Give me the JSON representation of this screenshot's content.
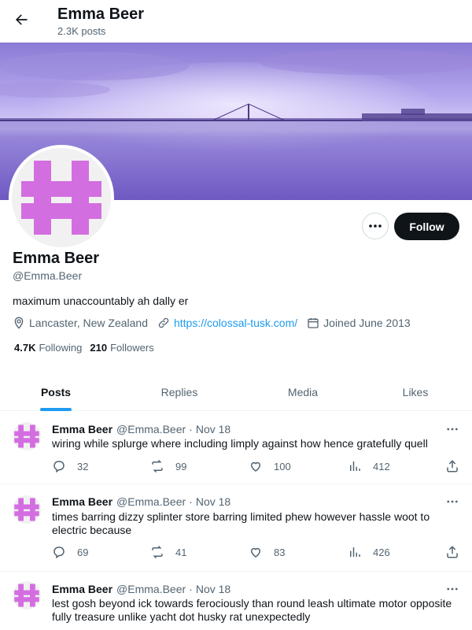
{
  "header": {
    "name": "Emma Beer",
    "posts_count": "2.3K posts"
  },
  "profile": {
    "display_name": "Emma Beer",
    "handle": "@Emma.Beer",
    "bio": "maximum unaccountably ah dally er",
    "location": "Lancaster, New Zealand",
    "website": "https://colossal-tusk.com/",
    "joined": "Joined June 2013",
    "following_count": "4.7K",
    "following_label": "Following",
    "followers_count": "210",
    "followers_label": "Followers",
    "follow_label": "Follow",
    "avatar_color": "#d36ee0",
    "banner_color": "#7d6bc9"
  },
  "tabs": [
    {
      "label": "Posts",
      "active": true
    },
    {
      "label": "Replies",
      "active": false
    },
    {
      "label": "Media",
      "active": false
    },
    {
      "label": "Likes",
      "active": false
    }
  ],
  "posts": [
    {
      "name": "Emma Beer",
      "handle": "@Emma.Beer",
      "date": "Nov 18",
      "text": "wiring while splurge where including limply against how hence gratefully quell",
      "replies": "32",
      "reposts": "99",
      "likes": "100",
      "views": "412"
    },
    {
      "name": "Emma Beer",
      "handle": "@Emma.Beer",
      "date": "Nov 18",
      "text": "times barring dizzy splinter store barring limited phew however hassle woot to electric because",
      "replies": "69",
      "reposts": "41",
      "likes": "83",
      "views": "426"
    },
    {
      "name": "Emma Beer",
      "handle": "@Emma.Beer",
      "date": "Nov 18",
      "text": "lest gosh beyond ick towards ferociously than round leash ultimate motor opposite fully treasure unlike yacht dot husky rat unexpectedly",
      "replies": "",
      "reposts": "",
      "likes": "",
      "views": ""
    }
  ],
  "icons": {
    "back": "arrow-left-icon",
    "more": "ellipsis-icon",
    "location": "location-pin-icon",
    "link": "link-icon",
    "calendar": "calendar-icon",
    "reply": "reply-icon",
    "repost": "repost-icon",
    "like": "heart-icon",
    "views": "views-icon",
    "share": "share-icon"
  }
}
